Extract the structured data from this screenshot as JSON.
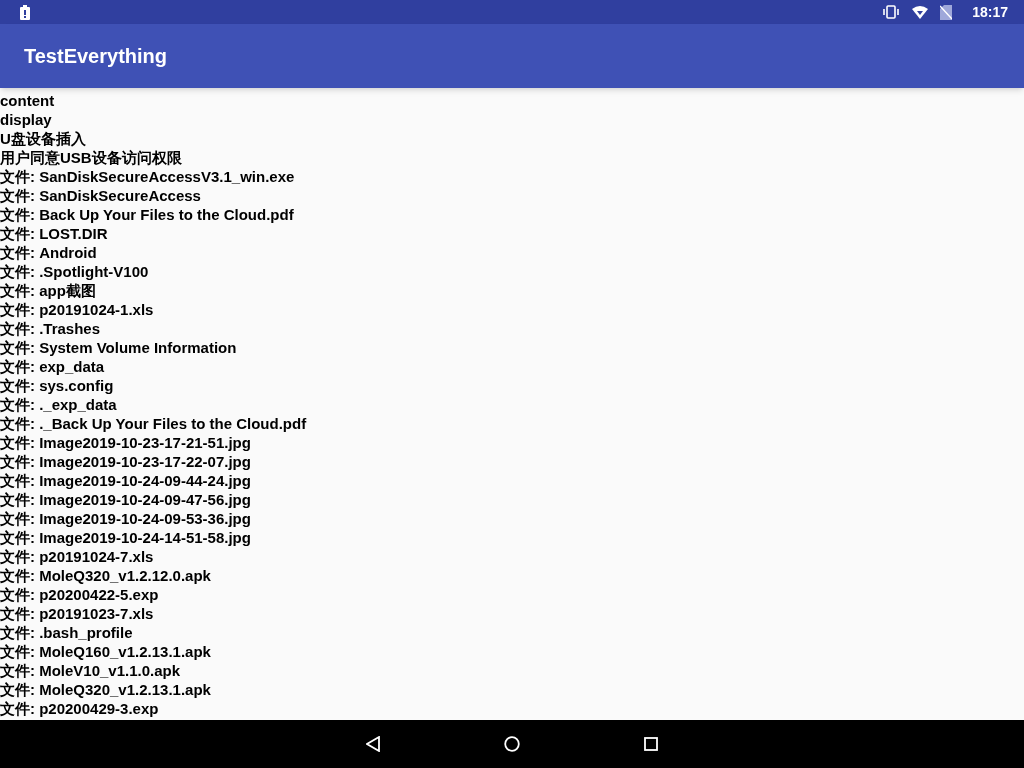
{
  "status_bar": {
    "time": "18:17"
  },
  "app_bar": {
    "title": "TestEverything"
  },
  "lines": [
    "content",
    "display",
    "U盘设备插入",
    "用户同意USB设备访问权限",
    "文件: SanDiskSecureAccessV3.1_win.exe",
    "文件: SanDiskSecureAccess",
    "文件: Back Up Your Files to the Cloud.pdf",
    "文件: LOST.DIR",
    "文件: Android",
    "文件: .Spotlight-V100",
    "文件: app截图",
    "文件: p20191024-1.xls",
    "文件: .Trashes",
    "文件: System Volume Information",
    "文件: exp_data",
    "文件: sys.config",
    "文件: ._exp_data",
    "文件: ._Back Up Your Files to the Cloud.pdf",
    "文件: Image2019-10-23-17-21-51.jpg",
    "文件: Image2019-10-23-17-22-07.jpg",
    "文件: Image2019-10-24-09-44-24.jpg",
    "文件: Image2019-10-24-09-47-56.jpg",
    "文件: Image2019-10-24-09-53-36.jpg",
    "文件: Image2019-10-24-14-51-58.jpg",
    "文件: p20191024-7.xls",
    "文件: MoleQ320_v1.2.12.0.apk",
    "文件: p20200422-5.exp",
    "文件: p20191023-7.xls",
    "文件: .bash_profile",
    "文件: MoleQ160_v1.2.13.1.apk",
    "文件: MoleV10_v1.1.0.apk",
    "文件: MoleQ320_v1.2.13.1.apk",
    "文件: p20200429-3.exp"
  ]
}
